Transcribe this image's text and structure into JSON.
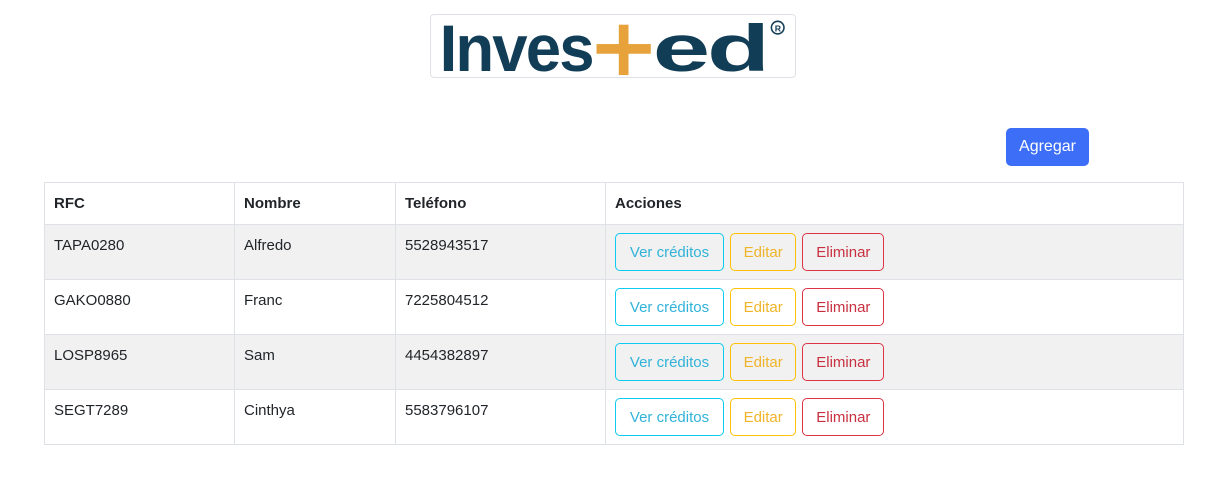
{
  "brand": {
    "logo_text": "Inves+ed",
    "registered_mark": "®",
    "colors": {
      "primary": "#123d56",
      "accent": "#e8a23b"
    }
  },
  "toolbar": {
    "add_label": "Agregar"
  },
  "table": {
    "headers": [
      "RFC",
      "Nombre",
      "Teléfono",
      "Acciones"
    ],
    "rows": [
      {
        "rfc": "TAPA0280",
        "nombre": "Alfredo",
        "telefono": "5528943517"
      },
      {
        "rfc": "GAKO0880",
        "nombre": "Franc",
        "telefono": "7225804512"
      },
      {
        "rfc": "LOSP8965",
        "nombre": "Sam",
        "telefono": "4454382897"
      },
      {
        "rfc": "SEGT7289",
        "nombre": "Cinthya",
        "telefono": "5583796107"
      }
    ],
    "actions": {
      "view_label": "Ver créditos",
      "edit_label": "Editar",
      "delete_label": "Eliminar"
    }
  }
}
